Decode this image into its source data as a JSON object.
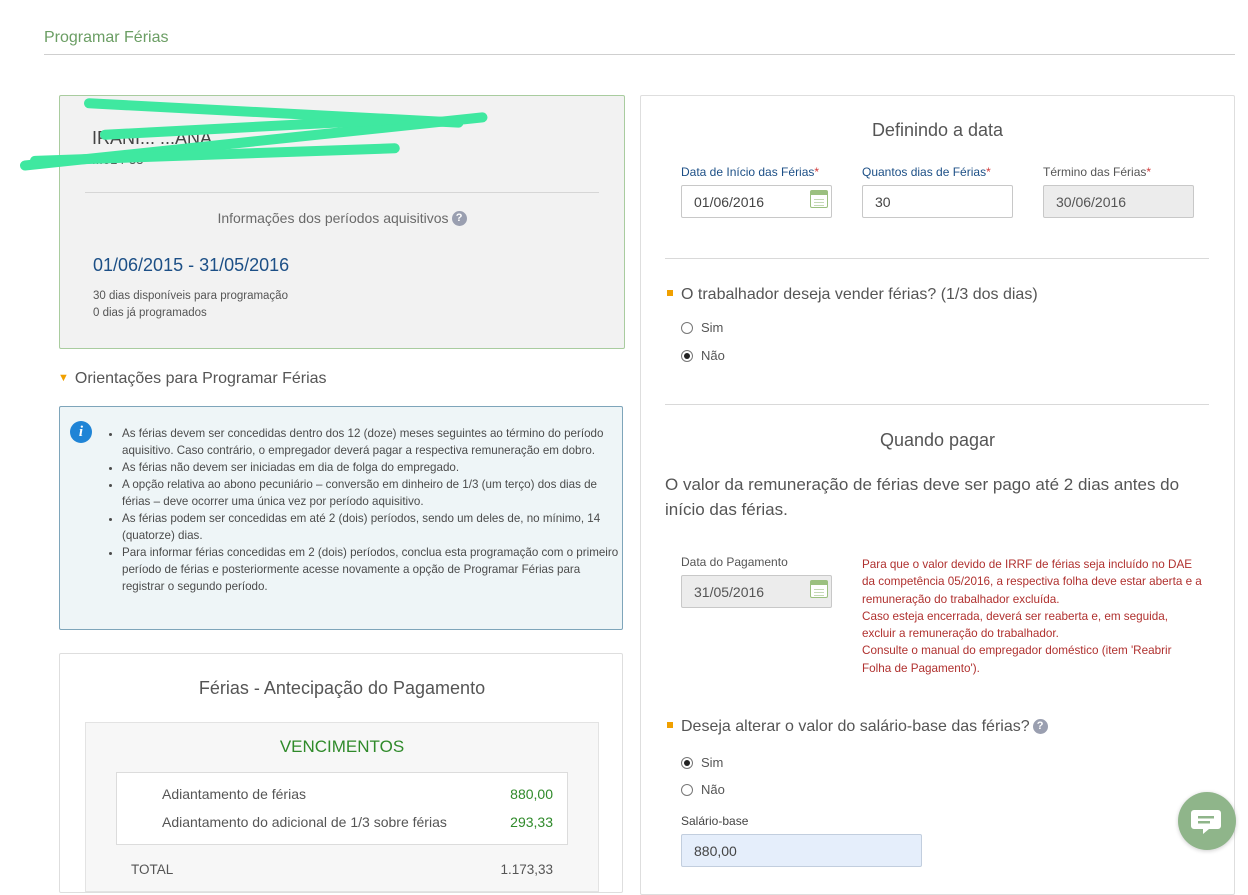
{
  "page": {
    "title": "Programar Férias"
  },
  "employee": {
    "name": "IRANI... ...ANA",
    "id": "...014-33",
    "periods_title": "Informações dos períodos aquisitivos",
    "period_range": "01/06/2015 - 31/05/2016",
    "available": "30 dias disponíveis para programação",
    "programmed": "0 dias já programados"
  },
  "orientations": {
    "toggle_label": "Orientações para Programar Férias",
    "items": [
      "As férias devem ser concedidas dentro dos 12 (doze) meses seguintes ao término do período aquisitivo. Caso contrário, o empregador deverá pagar a respectiva remuneração em dobro.",
      "As férias não devem ser iniciadas em dia de folga do empregado.",
      "A opção relativa ao abono pecuniário – conversão em dinheiro de 1/3 (um terço) dos dias de férias – deve ocorrer uma única vez por período aquisitivo.",
      "As férias podem ser concedidas em até 2 (dois) períodos, sendo um deles de, no mínimo, 14 (quatorze) dias.",
      "Para informar férias concedidas em 2 (dois) períodos, conclua esta programação com o primeiro período de férias e posteriormente acesse novamente a opção de Programar Férias para registrar o segundo período."
    ]
  },
  "advance": {
    "title": "Férias - Antecipação do Pagamento",
    "section": "VENCIMENTOS",
    "rows": [
      {
        "label": "Adiantamento de férias",
        "value": "880,00"
      },
      {
        "label": "Adiantamento do adicional de 1/3 sobre férias",
        "value": "293,33"
      }
    ],
    "total_label": "TOTAL",
    "total_value": "1.173,33"
  },
  "define_date": {
    "title": "Definindo a data",
    "start_label": "Data de Início das Férias",
    "start_value": "01/06/2016",
    "days_label": "Quantos dias de Férias",
    "days_value": "30",
    "end_label": "Término das Férias",
    "end_value": "30/06/2016",
    "required_mark": "*"
  },
  "sell": {
    "question": "O trabalhador deseja vender férias? (1/3 dos dias)",
    "options": [
      "Sim",
      "Não"
    ],
    "selected": "Não"
  },
  "when_pay": {
    "title": "Quando pagar",
    "notice": "O valor da remuneração de férias deve ser pago até 2 dias antes do início das férias.",
    "date_label": "Data do Pagamento",
    "date_value": "31/05/2016",
    "irrf_note": "Para que o valor devido de IRRF de férias seja incluído no DAE da competência 05/2016, a respectiva folha deve estar aberta e a remuneração do trabalhador excluída.\nCaso esteja encerrada, deverá ser reaberta e, em seguida, excluir a remuneração do trabalhador.\nConsulte o manual do empregador doméstico (item 'Reabrir Folha de Pagamento')."
  },
  "salary": {
    "question": "Deseja alterar o valor do salário-base das férias?",
    "options": [
      "Sim",
      "Não"
    ],
    "selected": "Sim",
    "base_label": "Salário-base",
    "base_value": "880,00"
  },
  "icons": {
    "help": "help-icon",
    "info": "info-icon",
    "calendar": "calendar-icon",
    "chat": "chat-icon"
  },
  "colors": {
    "accent_green": "#6b9e64",
    "value_green": "#2f8a2a",
    "link_blue": "#1c4f86",
    "warning_red": "#b0312f",
    "bullet_orange": "#f0a000"
  }
}
